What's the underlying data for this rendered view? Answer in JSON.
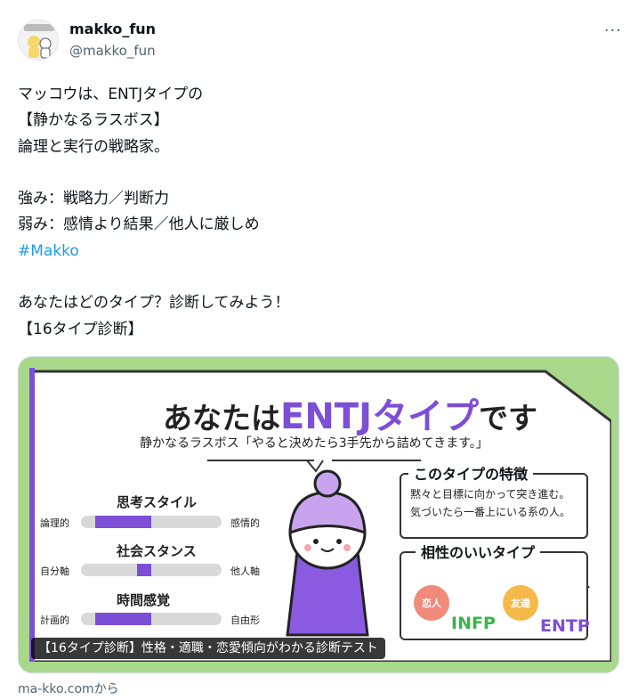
{
  "user": {
    "display_name": "makko_fun",
    "handle": "@makko_fun",
    "avatar_icon": "makko-avatar-icon"
  },
  "menu": {
    "more_label": "···"
  },
  "tweet": {
    "lines": [
      "マッコウは、ENTJタイプの",
      "【静かなるラスボス】",
      "論理と実行の戦略家。",
      "",
      "強み：戦略力／判断力",
      "弱み：感情より結果／他人に厳しめ"
    ],
    "hashtag": "#Makko",
    "lines_after": [
      "",
      "あなたはどのタイプ？診断してみよう！",
      "【16タイプ診断】"
    ]
  },
  "card": {
    "title_pre": "あなたは",
    "title_type": "ENTJタイプ",
    "title_post": "です",
    "subtitle": "静かなるラスボス「やると決めたら3手先から詰めてきます。」",
    "stats": [
      {
        "heading": "思考スタイル",
        "left": "論理的",
        "right": "感情的",
        "fill_start": 0.1,
        "fill_end": 0.5
      },
      {
        "heading": "社会スタンス",
        "left": "自分軸",
        "right": "他人軸",
        "fill_start": 0.4,
        "fill_end": 0.5
      },
      {
        "heading": "時間感覚",
        "left": "計画的",
        "right": "自由形",
        "fill_start": 0.1,
        "fill_end": 0.5
      }
    ],
    "feature_title": "このタイプの特徴",
    "feature_text": [
      "黙々と目標に向かって突き進む。",
      "気づいたら一番上にいる系の人。"
    ],
    "compat_title": "相性のいいタイプ",
    "compat": [
      {
        "badge": "恋人",
        "type": "INFP",
        "badge_color": "#f08a7a",
        "type_color": "#3bb34a"
      },
      {
        "badge": "友達",
        "type": "ENTP",
        "badge_color": "#f5b94a",
        "type_color": "#7d4ed6"
      }
    ],
    "caption": "【16タイプ診断】性格・適職・恋愛傾向がわかる診断テスト"
  },
  "source": "ma-kko.comから",
  "colors": {
    "accent": "#7d4ed6",
    "link": "#1d9bf0",
    "card_bg": "#a8d88a"
  }
}
